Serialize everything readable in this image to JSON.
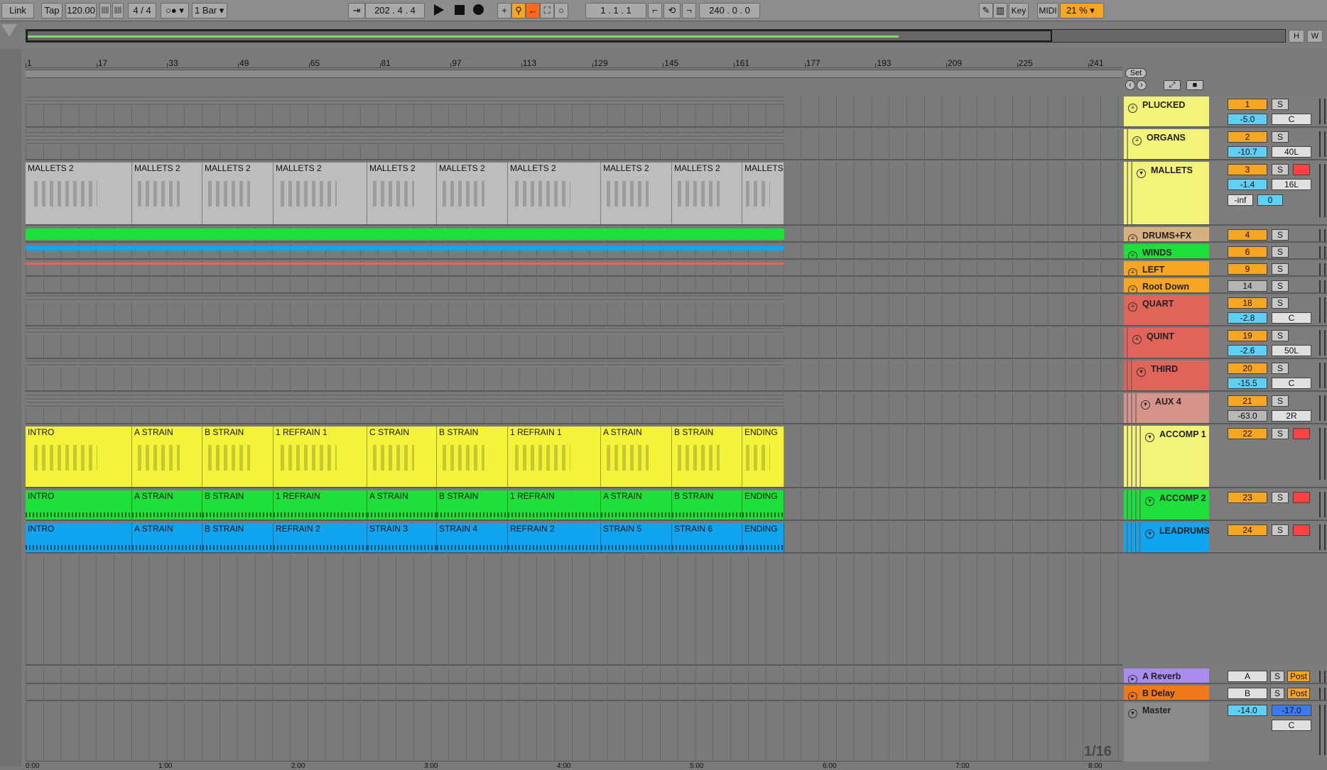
{
  "toolbar": {
    "link": "Link",
    "tap": "Tap",
    "tempo": "120.00",
    "signature_num": "4",
    "signature_sep": "/",
    "signature_den": "4",
    "quantize": "1 Bar",
    "arrangement_position": "202 .   4 .   4",
    "loop_start": "1 .   1 .   1",
    "loop_length": "240 .   0 .   0",
    "key": "Key",
    "midi": "MIDI",
    "cpu": "21 %",
    "help_h": "H",
    "help_w": "W"
  },
  "ruler": {
    "bars": [
      "1",
      "17",
      "33",
      "49",
      "65",
      "81",
      "97",
      "113",
      "129",
      "145",
      "161",
      "177",
      "193",
      "209",
      "225",
      "241"
    ]
  },
  "set_label": "Set",
  "timeline": {
    "labels": [
      "0:00",
      "1:00",
      "2:00",
      "3:00",
      "4:00",
      "5:00",
      "6:00",
      "7:00",
      "8:00"
    ]
  },
  "zoom_label": "1/16",
  "lanes": [
    {
      "name": "PLUCKED",
      "clips": []
    },
    {
      "name": "ORGANS",
      "clips": []
    },
    {
      "name": "MALLETS",
      "clips": [
        "MALLETS 2",
        "MALLETS 2",
        "MALLETS 2",
        "MALLETS 2",
        "MALLETS 2",
        "MALLETS 2",
        "MALLETS 2",
        "MALLETS 2",
        "MALLETS 2",
        "MALLETS"
      ]
    },
    {
      "name": "ACCOMP 1",
      "clips": [
        "INTRO",
        "A STRAIN",
        "B STRAIN",
        "1 REFRAIN 1",
        "C STRAIN",
        "B STRAIN",
        "1 REFRAIN 1",
        "A STRAIN",
        "B STRAIN",
        "ENDING"
      ]
    },
    {
      "name": "ACCOMP 2",
      "clips": [
        "INTRO",
        "A STRAIN",
        "B STRAIN",
        "1 REFRAIN",
        "A STRAIN",
        "B STRAIN",
        "1 REFRAIN",
        "A STRAIN",
        "B STRAIN",
        "ENDING"
      ]
    },
    {
      "name": "LEADRUMS",
      "clips": [
        "INTRO",
        "A STRAIN",
        "B STRAIN",
        "REFRAIN 2",
        "STRAIN 3",
        "STRAIN 4",
        "REFRAIN 2",
        "STRAIN 5",
        "STRAIN 6",
        "ENDING"
      ]
    }
  ],
  "tracks": [
    {
      "name": "PLUCKED",
      "num": "1",
      "solo": "S",
      "vol": "-5.0",
      "pan": "C",
      "color": "#f3f37a"
    },
    {
      "name": "ORGANS",
      "num": "2",
      "solo": "S",
      "vol": "-10.7",
      "pan": "40L",
      "color": "#f3f37a"
    },
    {
      "name": "MALLETS",
      "num": "3",
      "solo": "S",
      "vol": "-1.4",
      "pan": "16L",
      "sendA": "-inf",
      "sendB": "0",
      "color": "#f3f37a"
    },
    {
      "name": "DRUMS+FX",
      "num": "4",
      "solo": "S",
      "color": "#d6b07e"
    },
    {
      "name": "WINDS",
      "num": "6",
      "solo": "S",
      "color": "#1de13a"
    },
    {
      "name": "LEFT",
      "num": "9",
      "solo": "S",
      "color": "#f6a623"
    },
    {
      "name": "Root Down",
      "num": "14",
      "solo": "S",
      "color": "#f6a623"
    },
    {
      "name": "QUART",
      "num": "18",
      "solo": "S",
      "vol": "-2.8",
      "pan": "C",
      "color": "#e0645a"
    },
    {
      "name": "QUINT",
      "num": "19",
      "solo": "S",
      "vol": "-2.6",
      "pan": "50L",
      "color": "#e0645a"
    },
    {
      "name": "THIRD",
      "num": "20",
      "solo": "S",
      "vol": "-15.5",
      "pan": "C",
      "color": "#e0645a"
    },
    {
      "name": "AUX 4",
      "num": "21",
      "solo": "S",
      "vol": "-63.0",
      "pan": "2R",
      "color": "#d6938a"
    },
    {
      "name": "ACCOMP 1",
      "num": "22",
      "solo": "S",
      "color": "#f3f37a"
    },
    {
      "name": "ACCOMP 2",
      "num": "23",
      "solo": "S",
      "color": "#1de13a"
    },
    {
      "name": "LEADRUMS",
      "num": "24",
      "solo": "S",
      "color": "#11a4ef"
    }
  ],
  "returns": [
    {
      "name": "A Reverb",
      "letter": "A",
      "solo": "S",
      "mode": "Post",
      "color": "#a98cf0"
    },
    {
      "name": "B Delay",
      "letter": "B",
      "solo": "S",
      "mode": "Post",
      "color": "#f07a1a"
    }
  ],
  "master": {
    "name": "Master",
    "vol": "-14.0",
    "cue": "-17.0",
    "pan": "C"
  }
}
